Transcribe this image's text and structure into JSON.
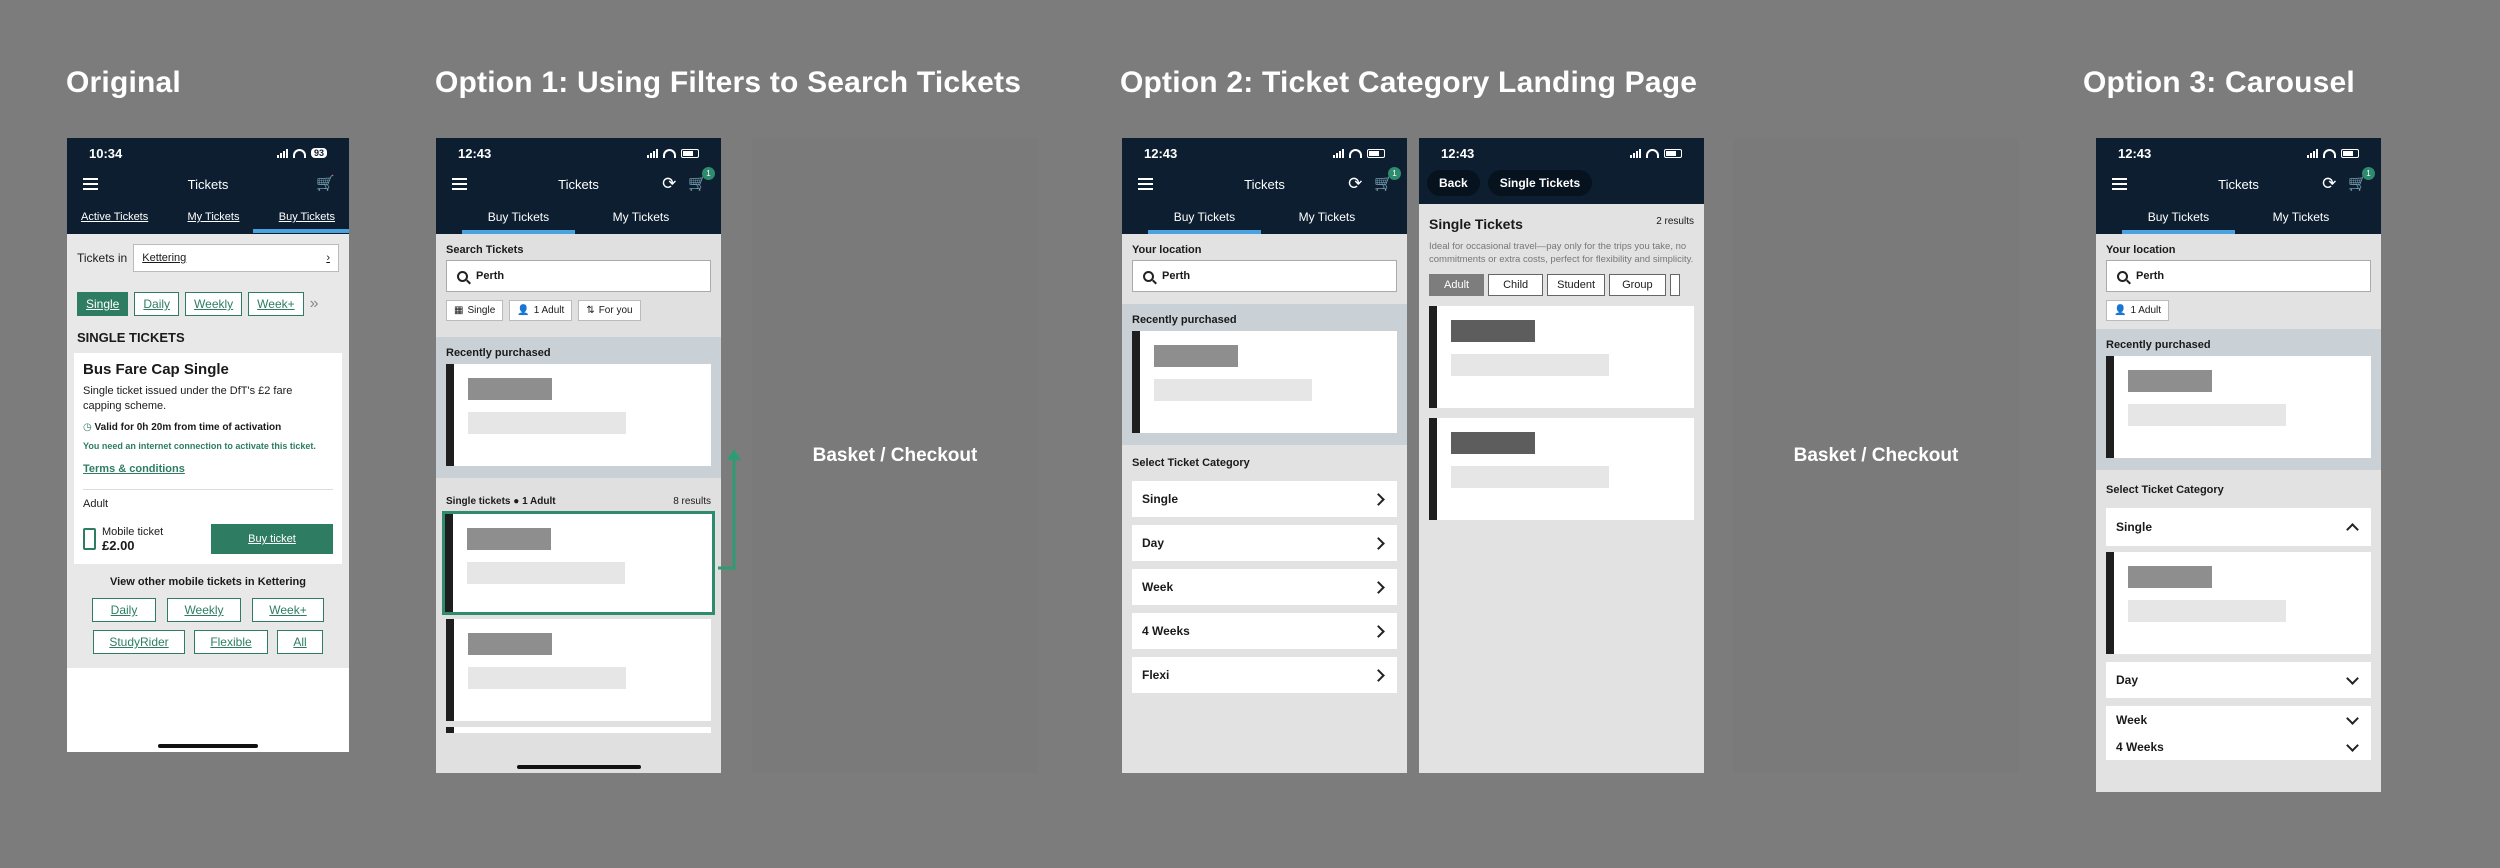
{
  "sections": {
    "original": "Original",
    "opt1": "Option 1: Using Filters to Search Tickets",
    "opt2": "Option 2: Ticket Category  Landing Page",
    "opt3": "Option 3: Carousel"
  },
  "basket": "Basket / Checkout",
  "original": {
    "time": "10:34",
    "battery": "93",
    "title": "Tickets",
    "tabs": [
      "Active Tickets",
      "My Tickets",
      "Buy Tickets"
    ],
    "tickets_in_label": "Tickets in",
    "location": "Kettering",
    "filters": [
      "Single",
      "Daily",
      "Weekly",
      "Week+"
    ],
    "more": "»",
    "heading": "SINGLE TICKETS",
    "card_title": "Bus Fare Cap Single",
    "card_desc": "Single ticket issued under the DfT's £2 fare capping scheme.",
    "valid": "Valid for 0h 20m from time of activation",
    "internet": "You need an internet connection to activate this ticket.",
    "terms": "Terms & conditions",
    "passenger": "Adult",
    "mobile": "Mobile ticket",
    "price": "£2.00",
    "buy": "Buy ticket",
    "other": "View other mobile tickets in Kettering",
    "other_row1": [
      "Daily",
      "Weekly",
      "Week+"
    ],
    "other_row2": [
      "StudyRider",
      "Flexible",
      "All"
    ]
  },
  "app": {
    "time": "12:43",
    "title": "Tickets",
    "cart_count": "1",
    "tab_buy": "Buy Tickets",
    "tab_my": "My Tickets",
    "search_value": "Perth"
  },
  "opt1": {
    "search_label": "Search Tickets",
    "chips": [
      "Single",
      "1 Adult",
      "For you"
    ],
    "recent": "Recently purchased",
    "results_label": "Single tickets",
    "results_adult": "1 Adult",
    "results_count": "8 results"
  },
  "opt2": {
    "your_location": "Your location",
    "recent": "Recently purchased",
    "select_cat": "Select Ticket Category",
    "categories": [
      "Single",
      "Day",
      "Week",
      "4 Weeks",
      "Flexi"
    ],
    "landing": {
      "back": "Back",
      "title": "Single Tickets",
      "heading": "Single Tickets",
      "count": "2 results",
      "desc": "Ideal for occasional travel—pay only for the trips you take, no commitments or extra costs, perfect for flexibility and simplicity.",
      "pills": [
        "Adult",
        "Child",
        "Student",
        "Group"
      ]
    }
  },
  "opt3": {
    "your_location": "Your location",
    "chip": "1 Adult",
    "recent": "Recently purchased",
    "select_cat": "Select Ticket Category",
    "categories": [
      "Single",
      "Day",
      "Week",
      "4 Weeks"
    ]
  }
}
